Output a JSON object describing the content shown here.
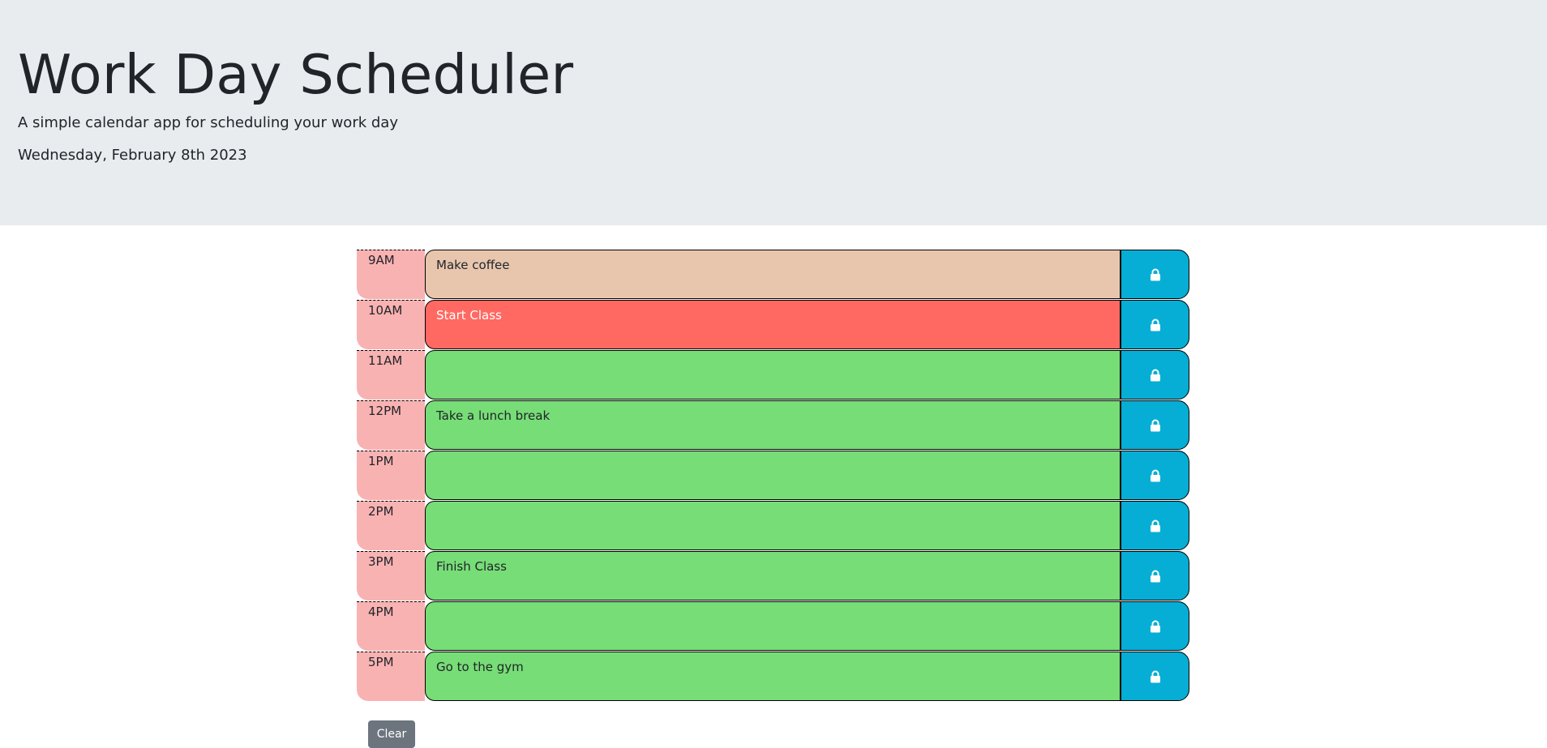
{
  "header": {
    "title": "Work Day Scheduler",
    "subtitle": "A simple calendar app for scheduling your work day",
    "date": "Wednesday, February 8th 2023"
  },
  "schedule": [
    {
      "hour": "9AM",
      "text": "Make coffee",
      "status": "past"
    },
    {
      "hour": "10AM",
      "text": "Start Class",
      "status": "present"
    },
    {
      "hour": "11AM",
      "text": "",
      "status": "future"
    },
    {
      "hour": "12PM",
      "text": "Take a lunch break",
      "status": "future"
    },
    {
      "hour": "1PM",
      "text": "",
      "status": "future"
    },
    {
      "hour": "2PM",
      "text": "",
      "status": "future"
    },
    {
      "hour": "3PM",
      "text": "Finish Class",
      "status": "future"
    },
    {
      "hour": "4PM",
      "text": "",
      "status": "future"
    },
    {
      "hour": "5PM",
      "text": "Go to the gym",
      "status": "future"
    }
  ],
  "save_icon": "lock-icon",
  "clear_label": "Clear",
  "colors": {
    "past": "#e8c6ae",
    "present": "#ff6962",
    "future": "#77dd77",
    "hour_bg": "#f9b2b2",
    "save_bg": "#06aed5",
    "header_bg": "#e8ecef",
    "clear_bg": "#6c757d"
  }
}
